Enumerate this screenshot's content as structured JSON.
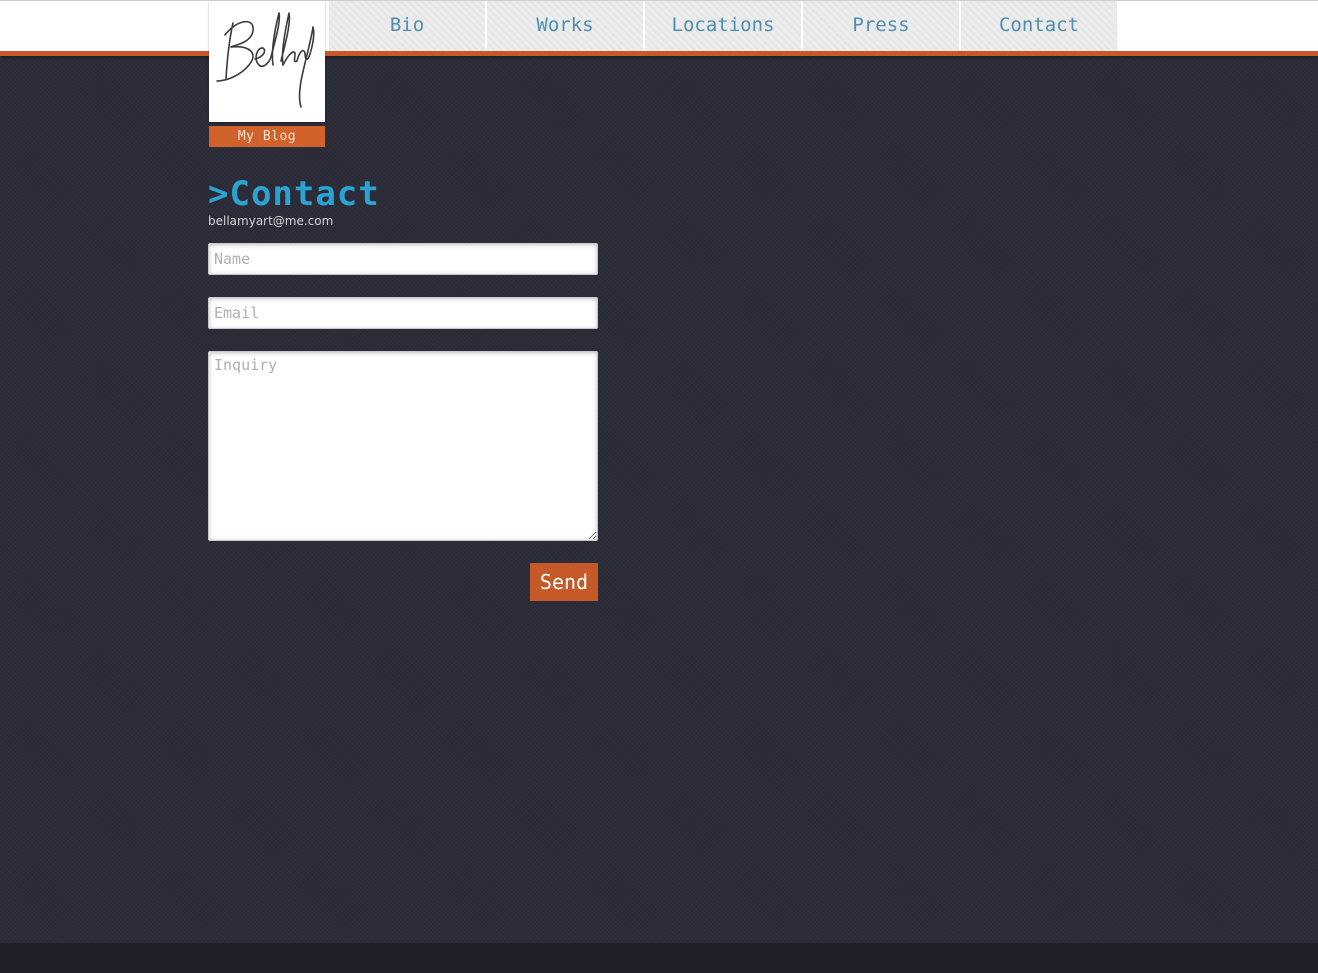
{
  "header": {
    "logo_icon": "bellamy-signature-logo",
    "blog_label": "My Blog",
    "nav": [
      {
        "label": "Bio"
      },
      {
        "label": "Works"
      },
      {
        "label": "Locations"
      },
      {
        "label": "Press"
      },
      {
        "label": "Contact"
      }
    ]
  },
  "main": {
    "heading": ">Contact",
    "email": "bellamyart@me.com",
    "form": {
      "name_placeholder": "Name",
      "name_value": "",
      "email_placeholder": "Email",
      "email_value": "",
      "inquiry_placeholder": "Inquiry",
      "inquiry_value": "",
      "send_label": "Send"
    }
  },
  "colors": {
    "background": "#2b2c38",
    "accent_orange": "#c8582a",
    "heading_blue": "#2aa3d2",
    "nav_text_blue": "#4f8fad",
    "nav_tab_bg": "#ececec",
    "footer": "#1f1f29"
  }
}
